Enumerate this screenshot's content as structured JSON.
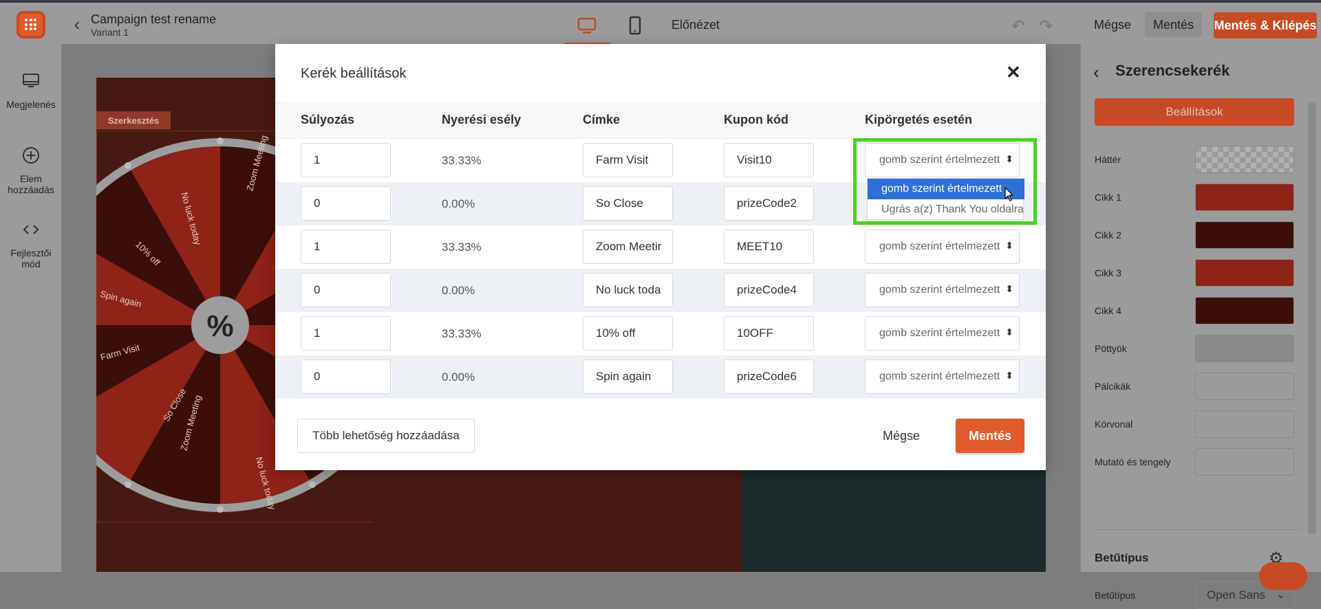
{
  "header": {
    "campaign_title": "Campaign test rename",
    "variant": "Variant 1",
    "preview_label": "Előnézet",
    "cancel_label": "Mégse",
    "save_label": "Mentés",
    "save_exit_label": "Mentés & Kilépés"
  },
  "leftbar": {
    "items": [
      {
        "label": "Megjelenés",
        "icon": "monitor-icon"
      },
      {
        "label": "Elem hozzáadás",
        "icon": "plus-circle-icon"
      },
      {
        "label": "Fejlesztői mód",
        "icon": "code-icon"
      }
    ]
  },
  "canvas": {
    "edit_tag": "Szerkesztés",
    "wheel_center": "%",
    "wheel_labels": [
      "So Close",
      "Zoom Meeting",
      "No luck today",
      "Farm Visit",
      "Spin again",
      "10% off",
      "No luck today",
      "Zoom Meeting"
    ]
  },
  "modal": {
    "title": "Kerék beállítások",
    "columns": [
      "Súlyozás",
      "Nyerési esély",
      "Címke",
      "Kupon kód",
      "Kipörgetés esetén"
    ],
    "rows": [
      {
        "weight": "1",
        "chance": "33.33%",
        "label": "Farm Visit",
        "coupon": "Visit10",
        "action": "gomb szerint értelmezett"
      },
      {
        "weight": "0",
        "chance": "0.00%",
        "label": "So Close",
        "coupon": "prizeCode2",
        "action": "gomb szerint értelmezett"
      },
      {
        "weight": "1",
        "chance": "33.33%",
        "label": "Zoom Meetir",
        "coupon": "MEET10",
        "action": "gomb szerint értelmezett"
      },
      {
        "weight": "0",
        "chance": "0.00%",
        "label": "No luck toda",
        "coupon": "prizeCode4",
        "action": "gomb szerint értelmezett"
      },
      {
        "weight": "1",
        "chance": "33.33%",
        "label": "10% off",
        "coupon": "10OFF",
        "action": "gomb szerint értelmezett"
      },
      {
        "weight": "0",
        "chance": "0.00%",
        "label": "Spin again",
        "coupon": "prizeCode6",
        "action": "gomb szerint értelmezett"
      }
    ],
    "dropdown_options": [
      "gomb szerint értelmezett",
      "Ugrás a(z) Thank You oldalra"
    ],
    "add_more_label": "Több lehetőség hozzáadása",
    "cancel_label": "Mégse",
    "save_label": "Mentés"
  },
  "rightpanel": {
    "title": "Szerencsekerék",
    "settings_label": "Beállítások",
    "rows": [
      {
        "label": "Háttér",
        "color": "checker"
      },
      {
        "label": "Cikk 1",
        "color": "#8e2318"
      },
      {
        "label": "Cikk 2",
        "color": "#3a0e0a"
      },
      {
        "label": "Cikk 3",
        "color": "#8e2318"
      },
      {
        "label": "Cikk 4",
        "color": "#3a0e0a"
      },
      {
        "label": "Pöttyök",
        "color": "#8a8a8a"
      },
      {
        "label": "Pálcikák",
        "color": "#9b9b9b"
      },
      {
        "label": "Körvonal",
        "color": "#9b9b9b"
      },
      {
        "label": "Mutató és tengely",
        "color": "#9b9b9b"
      }
    ],
    "font_section_title": "Betűtípus",
    "font_label": "Betűtípus",
    "font_value": "Open Sans"
  }
}
